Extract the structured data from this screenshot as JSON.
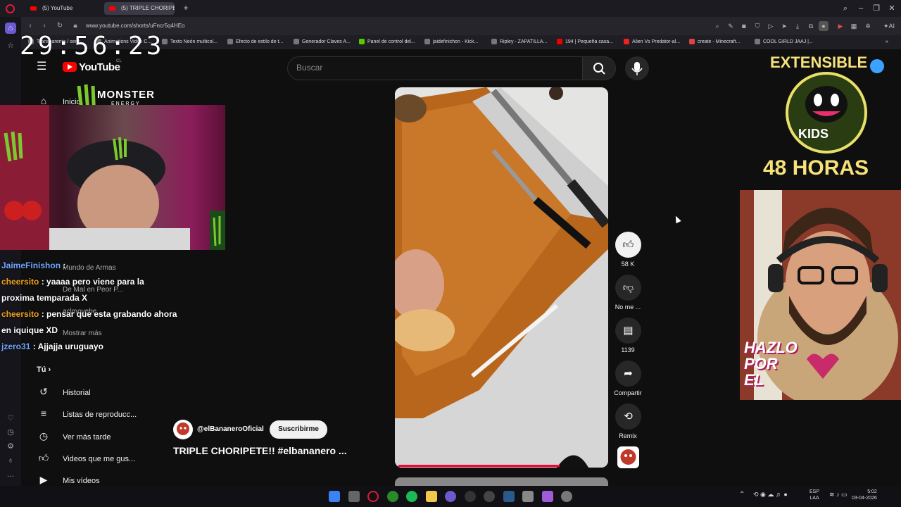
{
  "browser": {
    "tabs": [
      {
        "label": "(5) YouTube"
      },
      {
        "label": "(5) TRIPLE CHORIPETE"
      }
    ],
    "url": "www.youtube.com/shorts/uFncr5q4HEo",
    "bookmarks": [
      "Transparenta / semi...",
      "Animations Video C...",
      "Texto Neón multicol...",
      "Efecto de estilo de t...",
      "Generador Claves A...",
      "Panel de control del...",
      "jaidefinichon - Kick...",
      "Ripley - ZAPATILLA...",
      "194 | Pequeña casa...",
      "Alien Vs Predator-al...",
      "create - Minecraft...",
      "COOL GIRLD JAAJ |..."
    ]
  },
  "youtube": {
    "logo_text": "YouTube",
    "country": "CL",
    "search_placeholder": "Buscar",
    "nav": {
      "home": "Inicio",
      "sub1": "Mundo de Armas",
      "sub2": "De Mal en Peor P...",
      "sub3": "aclmovebe",
      "more": "Mostrar más",
      "you": "Tú",
      "history": "Historial",
      "playlists": "Listas de reproducc...",
      "watch_later": "Ver más tarde",
      "liked": "Videos que me gus...",
      "my_videos": "Mis vídeos"
    },
    "short": {
      "channel": "@elBananeroOficial",
      "subscribe_label": "Suscribirme",
      "title": "TRIPLE CHORIPETE!! #elbananero ...",
      "progress": 0.78
    },
    "actions": {
      "likes": "58 K",
      "dislike_label": "No me ...",
      "comments": "1139",
      "share_label": "Compartir",
      "remix_label": "Remix"
    }
  },
  "overlay": {
    "timer": "29:56:23",
    "monster_brand": "MONSTER",
    "monster_sub": "ENERGY",
    "chat": [
      {
        "user": "JaimeFinishon",
        "user_color": "#6fa8ff",
        "text": ""
      },
      {
        "user": "cheersito",
        "user_color": "#f0a020",
        "text": "yaaaa pero viene para la proxima temparada X"
      },
      {
        "user": "cheersito",
        "user_color": "#f0a020",
        "text": "pensar que esta grabando ahora en iquique XD"
      },
      {
        "user": "jzero31",
        "user_color": "#6fa8ff",
        "text": "Ajjajja uruguayo"
      }
    ],
    "extensible_title": "EXTENSIBLE",
    "extensible_kids": "KIDS",
    "extensible_hours": "48 HORAS",
    "art_text_1": "HAZLO",
    "art_text_2": "POR",
    "art_text_3": "EL"
  },
  "taskbar": {
    "lang_1": "ESP",
    "lang_2": "LAA",
    "time": "5:02",
    "date": "03-04-2026"
  },
  "colors": {
    "accent": "#ff0033",
    "yt_bg": "#0f0f0f",
    "monster_green": "#7ec82f"
  }
}
